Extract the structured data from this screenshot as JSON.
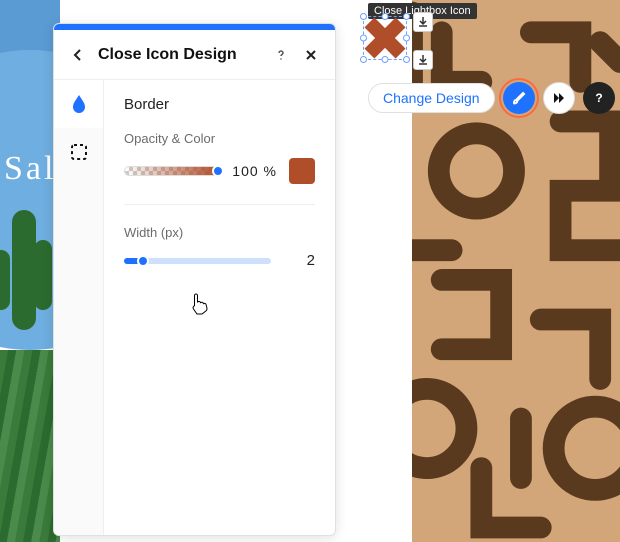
{
  "tooltip": "Close Lightbox Icon",
  "panel": {
    "title": "Close Icon Design",
    "section": "Border",
    "opacity": {
      "label": "Opacity & Color",
      "value_display": "100 %",
      "swatch_color": "#b14e2a"
    },
    "width": {
      "label": "Width (px)",
      "value": "2"
    }
  },
  "toolbar": {
    "change_design": "Change Design"
  },
  "bg": {
    "sale": "Sal"
  }
}
